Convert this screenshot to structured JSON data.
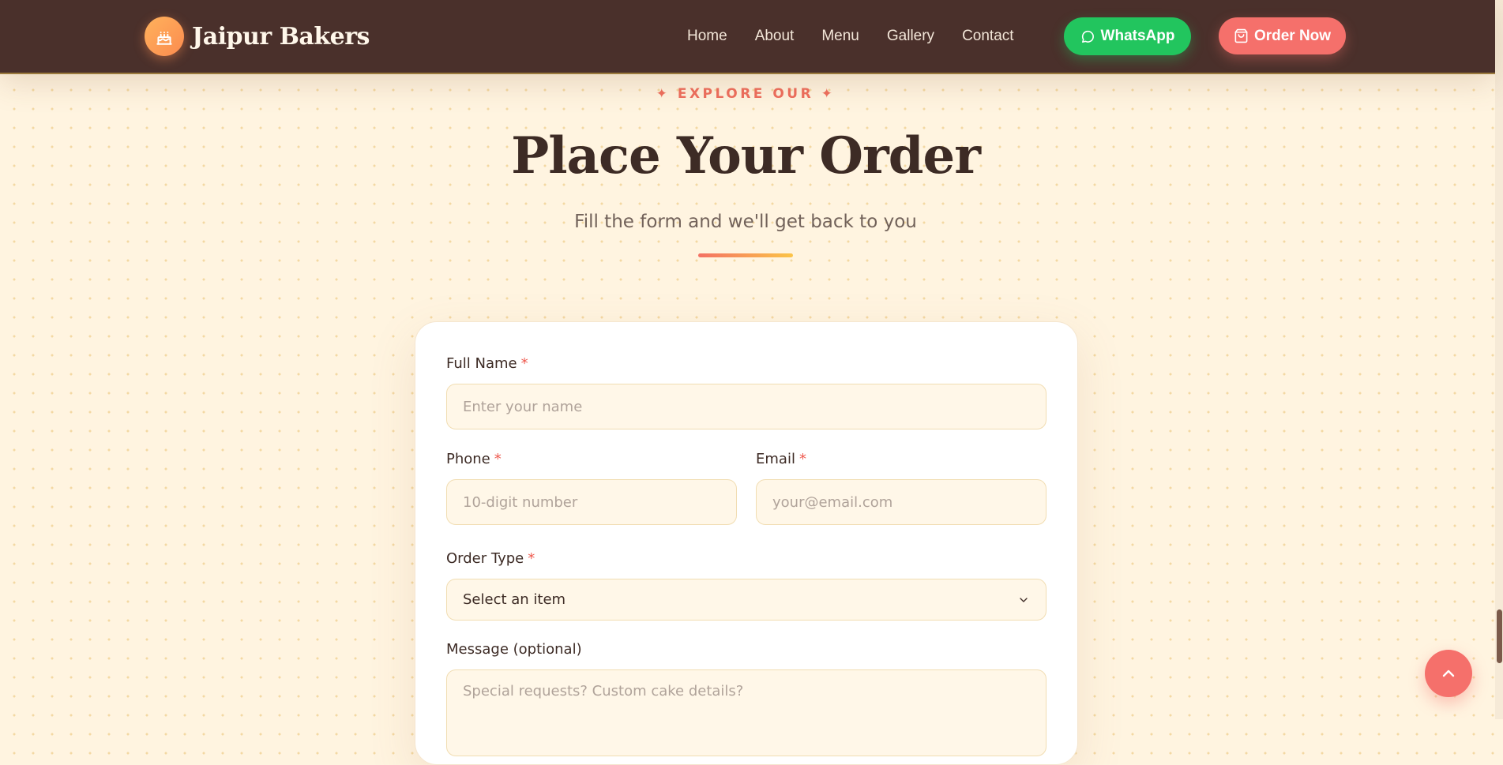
{
  "brand": {
    "name": "Jaipur Bakers",
    "icon": "cake-icon"
  },
  "nav": {
    "items": [
      "Home",
      "About",
      "Menu",
      "Gallery",
      "Contact"
    ],
    "whatsapp_label": "WhatsApp",
    "order_label": "Order Now"
  },
  "section": {
    "eyebrow": "✦ EXPLORE OUR ✦",
    "title": "Place Your Order",
    "subtitle": "Fill the form and we'll get back to you"
  },
  "form": {
    "full_name": {
      "label": "Full Name",
      "required": "*",
      "placeholder": "Enter your name"
    },
    "phone": {
      "label": "Phone",
      "required": "*",
      "placeholder": "10-digit number"
    },
    "email": {
      "label": "Email",
      "required": "*",
      "placeholder": "your@email.com"
    },
    "order_type": {
      "label": "Order Type",
      "required": "*",
      "selected": "Select an item"
    },
    "message": {
      "label": "Message (optional)",
      "placeholder": "Special requests? Custom cake details?"
    }
  },
  "colors": {
    "header_bg": "#4a302b",
    "accent": "#f5706b",
    "whatsapp": "#22c55e",
    "page_bg": "#fff4e0"
  }
}
